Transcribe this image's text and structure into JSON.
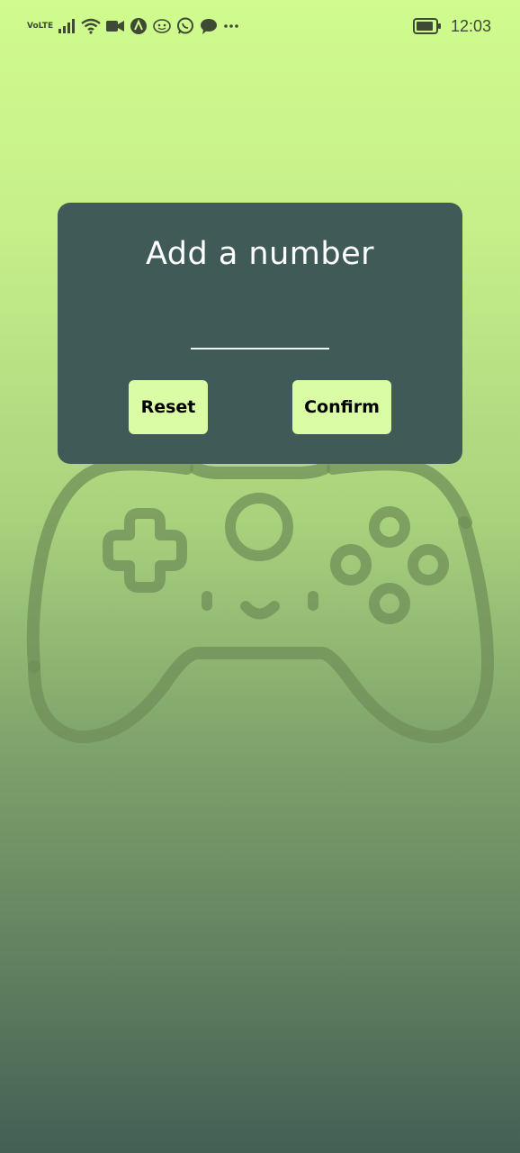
{
  "status_bar": {
    "network_label": "Vo\nLTE",
    "network_top": "Vo",
    "network_bottom": "LTE",
    "time": "12:03",
    "icons": [
      "volte-icon",
      "signal-icon",
      "wifi-icon",
      "video-call-icon",
      "app-a-icon",
      "app-sticker-icon",
      "whatsapp-icon",
      "chat-bubble-icon",
      "more-icon",
      "battery-icon"
    ],
    "icon_color": "#3e4a33"
  },
  "background": {
    "illustration": "game-controller-icon",
    "gradient_top": "#d0fb8e",
    "gradient_bottom": "#435f55"
  },
  "dialog": {
    "title": "Add a number",
    "input_value": "",
    "reset_label": "Reset",
    "confirm_label": "Confirm",
    "background_color": "#405b57",
    "button_color": "#d9fca4"
  }
}
